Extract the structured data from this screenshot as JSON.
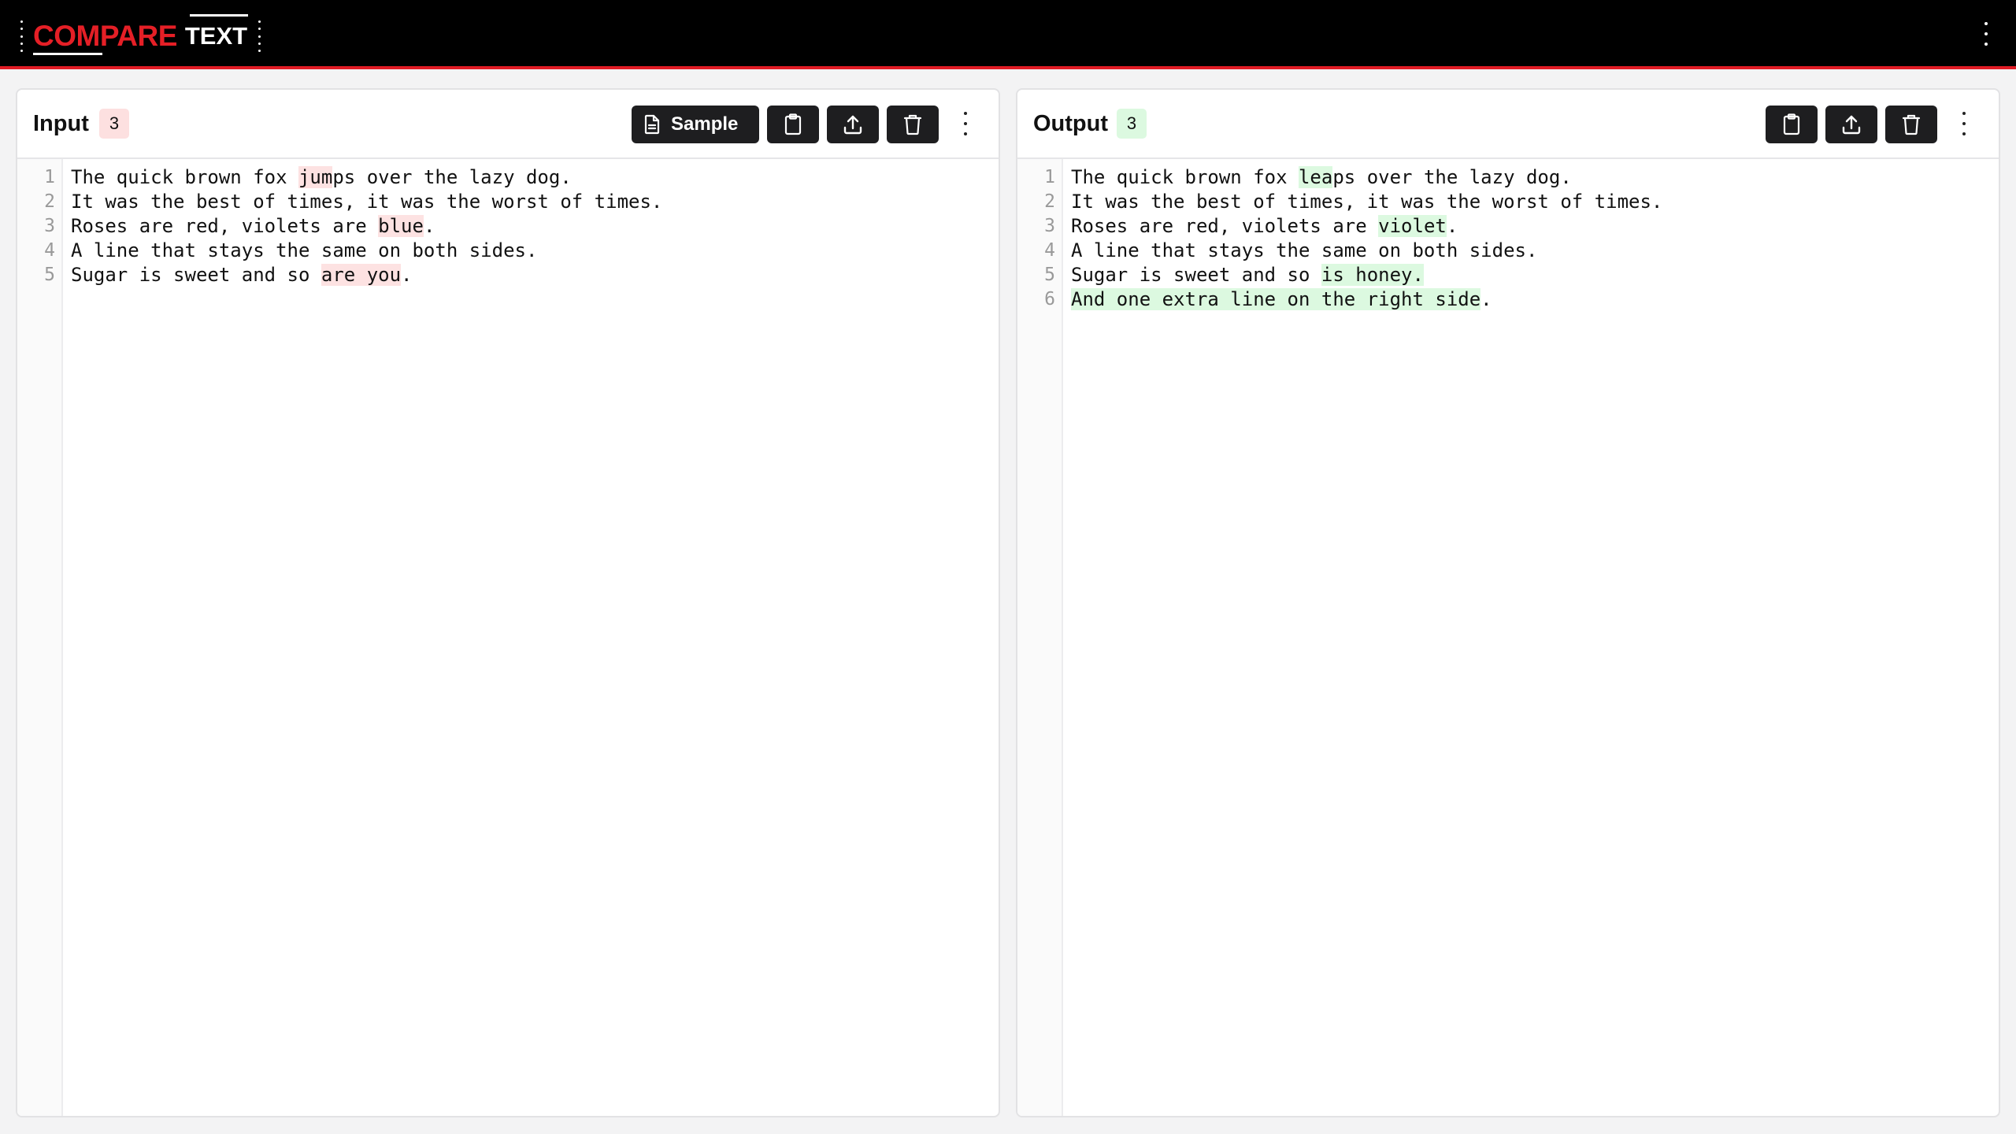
{
  "app": {
    "logo_word1": "COMPARE",
    "logo_word2": "TEXT"
  },
  "colors": {
    "brand_red": "#e51f26",
    "deletion_bg": "#fde2e2",
    "insertion_bg": "#dcf9e0",
    "button_dark": "#1e1e20"
  },
  "input": {
    "title": "Input",
    "count": "3",
    "sample_label": "Sample",
    "buttons": [
      "sample-icon",
      "clipboard-icon",
      "upload-icon",
      "trash-icon",
      "more-vertical-icon"
    ],
    "lines": [
      {
        "n": "1",
        "segments": [
          {
            "t": "The quick brown fox "
          },
          {
            "t": "jum",
            "m": "del"
          },
          {
            "t": "ps over the lazy dog."
          }
        ]
      },
      {
        "n": "2",
        "segments": [
          {
            "t": "It was the best of times, it was the worst of times."
          }
        ]
      },
      {
        "n": "3",
        "segments": [
          {
            "t": "Roses are red, violets are "
          },
          {
            "t": "blue",
            "m": "del"
          },
          {
            "t": "."
          }
        ]
      },
      {
        "n": "4",
        "segments": [
          {
            "t": "A line that stays the same on both sides."
          }
        ]
      },
      {
        "n": "5",
        "segments": [
          {
            "t": "Sugar is sweet and so "
          },
          {
            "t": "are you",
            "m": "del"
          },
          {
            "t": "."
          }
        ]
      }
    ]
  },
  "output": {
    "title": "Output",
    "count": "3",
    "buttons": [
      "clipboard-icon",
      "upload-icon",
      "trash-icon",
      "more-vertical-icon"
    ],
    "lines": [
      {
        "n": "1",
        "segments": [
          {
            "t": "The quick brown fox "
          },
          {
            "t": "lea",
            "m": "ins"
          },
          {
            "t": "ps over the lazy dog."
          }
        ]
      },
      {
        "n": "2",
        "segments": [
          {
            "t": "It was the best of times, it was the worst of times."
          }
        ]
      },
      {
        "n": "3",
        "segments": [
          {
            "t": "Roses are red, violets are "
          },
          {
            "t": "violet",
            "m": "ins"
          },
          {
            "t": "."
          }
        ]
      },
      {
        "n": "4",
        "segments": [
          {
            "t": "A line that stays the same on both sides."
          }
        ]
      },
      {
        "n": "5",
        "segments": [
          {
            "t": "Sugar is sweet and so "
          },
          {
            "t": "is honey.",
            "m": "ins"
          }
        ]
      },
      {
        "n": "6",
        "segments": [
          {
            "t": "And one extra line on the right side",
            "m": "ins"
          },
          {
            "t": "."
          }
        ]
      }
    ]
  }
}
